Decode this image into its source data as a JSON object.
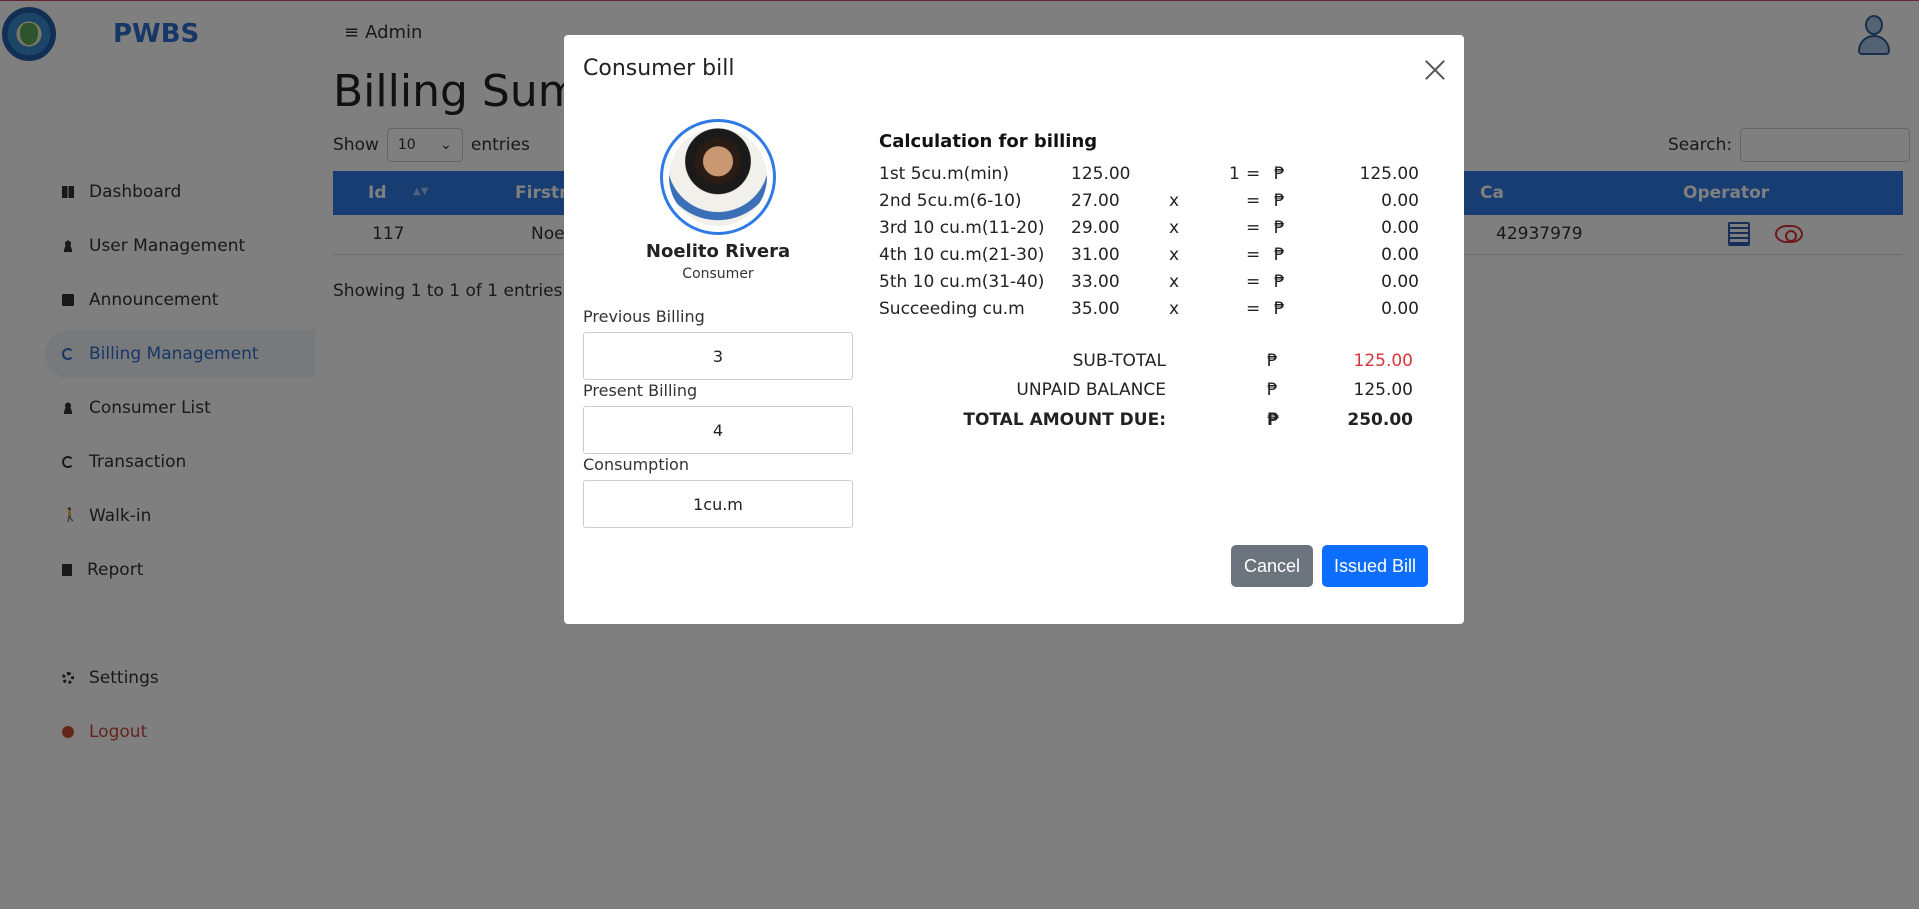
{
  "app": {
    "brand": "PWBS",
    "user_menu_label": "Admin",
    "menu_icon": "≡"
  },
  "sidebar": {
    "items": [
      {
        "label": "Dashboard",
        "icon": "dashboard-icon"
      },
      {
        "label": "User Management",
        "icon": "user-icon"
      },
      {
        "label": "Announcement",
        "icon": "mail-icon"
      },
      {
        "label": "Billing Management",
        "icon": "billing-icon",
        "active": true
      },
      {
        "label": "Consumer List",
        "icon": "users-icon"
      },
      {
        "label": "Transaction",
        "icon": "transaction-icon"
      },
      {
        "label": "Walk-in",
        "icon": "walk-icon"
      },
      {
        "label": "Report",
        "icon": "report-icon"
      },
      {
        "label": "Settings",
        "icon": "gear-icon"
      },
      {
        "label": "Logout",
        "icon": "logout-icon"
      }
    ]
  },
  "page": {
    "title": "Billing Summ",
    "show_label": "Show",
    "entries_value": "10",
    "entries_label": "entries",
    "search_label": "Search:",
    "search_value": "",
    "columns": [
      "Id",
      "Firstna",
      "Ca",
      "Operator"
    ],
    "rows": [
      {
        "id": "117",
        "firstname": "Noe",
        "ca": "42937979"
      }
    ],
    "showing_text": "Showing 1 to 1 of 1 entries"
  },
  "modal": {
    "title": "Consumer bill",
    "consumer": {
      "name": "Noelito Rivera",
      "role": "Consumer"
    },
    "fields": [
      {
        "label": "Previous Billing",
        "value": "3"
      },
      {
        "label": "Present Billing",
        "value": "4"
      },
      {
        "label": "Consumption",
        "value": "1cu.m"
      }
    ],
    "calc_title": "Calculation for billing",
    "peso_sign": "₱",
    "calc_rows": [
      {
        "label": "1st 5cu.m(min)",
        "rate": "125.00",
        "x": "",
        "qty": "1",
        "eq": "=",
        "amount": "125.00"
      },
      {
        "label": "2nd 5cu.m(6-10)",
        "rate": "27.00",
        "x": "x",
        "qty": "",
        "eq": "=",
        "amount": "0.00"
      },
      {
        "label": "3rd 10 cu.m(11-20)",
        "rate": "29.00",
        "x": "x",
        "qty": "",
        "eq": "=",
        "amount": "0.00"
      },
      {
        "label": "4th 10 cu.m(21-30)",
        "rate": "31.00",
        "x": "x",
        "qty": "",
        "eq": "=",
        "amount": "0.00"
      },
      {
        "label": "5th 10 cu.m(31-40)",
        "rate": "33.00",
        "x": "x",
        "qty": "",
        "eq": "=",
        "amount": "0.00"
      },
      {
        "label": "Succeeding cu.m",
        "rate": "35.00",
        "x": "x",
        "qty": "",
        "eq": "=",
        "amount": "0.00"
      }
    ],
    "summary": [
      {
        "label": "SUB-TOTAL",
        "amount": "125.00",
        "highlight": "#d8343a"
      },
      {
        "label": "UNPAID BALANCE",
        "amount": "125.00"
      },
      {
        "label": "TOTAL AMOUNT DUE:",
        "amount": "250.00",
        "bold": true
      }
    ],
    "cancel_label": "Cancel",
    "issue_label": "Issued Bill"
  },
  "colors": {
    "primary": "#0d6efd",
    "table_header": "#2f7ae5",
    "cancel": "#6c757d",
    "danger": "#d8343a"
  }
}
